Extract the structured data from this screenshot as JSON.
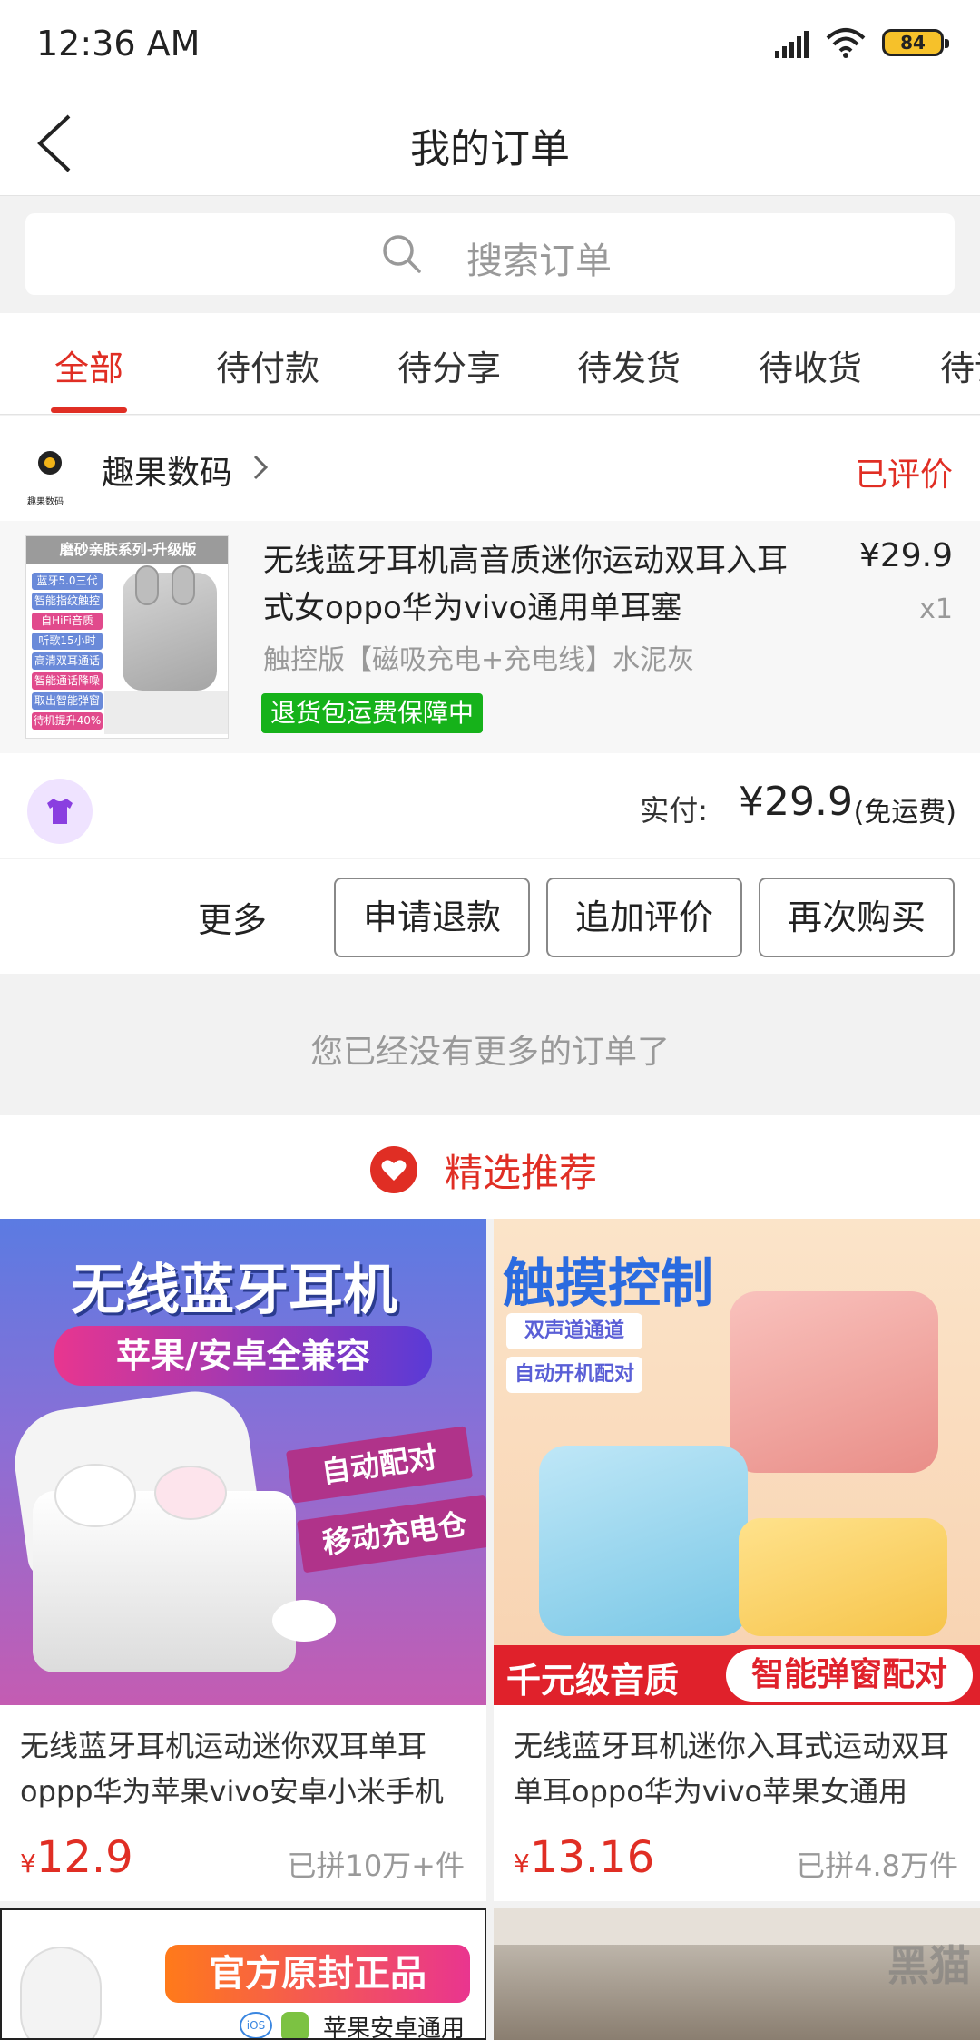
{
  "status_bar": {
    "time": "12:36  AM",
    "battery": "84"
  },
  "nav": {
    "title": "我的订单"
  },
  "search": {
    "placeholder": "搜索订单"
  },
  "tabs": [
    "全部",
    "待付款",
    "待分享",
    "待发货",
    "待收货",
    "待评价"
  ],
  "order": {
    "shop_name": "趣果数码",
    "shop_logo_text": "趣果数码",
    "status": "已评价",
    "item": {
      "thumb_banner": "磨砂亲肤系列-升级版",
      "thumb_features": [
        "蓝牙5.0三代",
        "智能指纹触控",
        "自HiFi音质",
        "听歌15小时",
        "高清双耳通话",
        "智能通话降噪",
        "取出智能弹窗",
        "待机提升40%"
      ],
      "title": "无线蓝牙耳机高音质迷你运动双耳入耳式女oppo华为vivo通用单耳塞",
      "sku": "触控版【磁吸充电+充电线】水泥灰",
      "guarantee": "退货包运费保障中",
      "price": "¥29.9",
      "qty": "x1"
    },
    "pay_label": "实付:",
    "pay_amount": "¥29.9",
    "pay_note": "(免运费)",
    "actions": {
      "more": "更多",
      "refund": "申请退款",
      "review": "追加评价",
      "rebuy": "再次购买"
    }
  },
  "no_more": "您已经没有更多的订单了",
  "recommend": {
    "title": "精选推荐",
    "products": [
      {
        "img_headline": "无线蓝牙耳机",
        "img_pill": "苹果/安卓全兼容",
        "img_tags": [
          "自动配对",
          "移动充电仓"
        ],
        "title": "无线蓝牙耳机运动迷你双耳单耳oppp华为苹果vivo安卓小米手机",
        "price_symbol": "¥",
        "price": "12.9",
        "sold": "已拼10万+件"
      },
      {
        "img_headline": "触摸控制",
        "img_tags": [
          "双声道通道",
          "自动开机配对"
        ],
        "img_bottom_left": "千元级音质",
        "img_bottom_right": "智能弹窗配对",
        "title": "无线蓝牙耳机迷你入耳式运动双耳单耳oppo华为vivo苹果女通用",
        "price_symbol": "¥",
        "price": "13.16",
        "sold": "已拼4.8万件"
      }
    ],
    "partial_banner": "官方原封正品",
    "partial_sub": "苹果安卓通用"
  },
  "watermark": "黑猫",
  "colors": {
    "accent": "#e02e24",
    "guarantee_green": "#16b21a"
  }
}
